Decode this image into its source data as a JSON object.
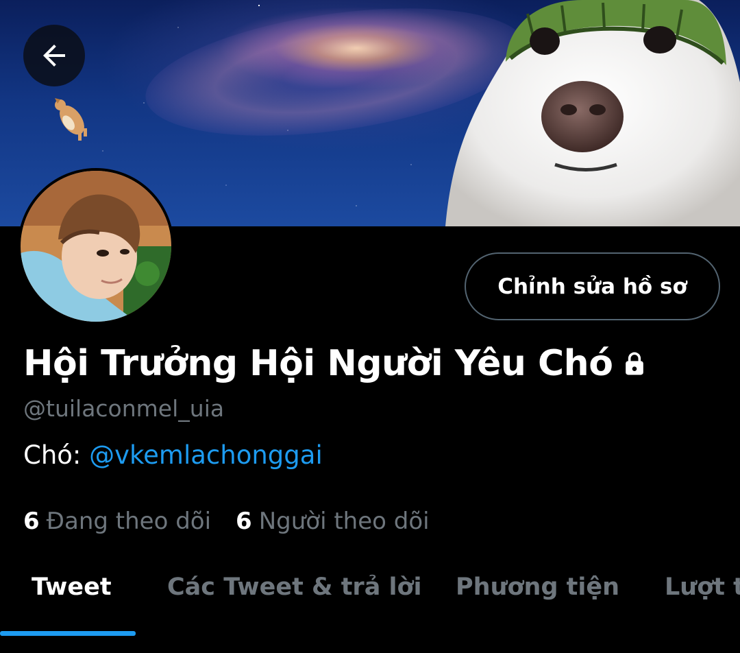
{
  "header": {
    "back_icon": "arrow-left-icon"
  },
  "profile": {
    "edit_button_label": "Chỉnh sửa hồ sơ",
    "display_name": "Hội Trưởng Hội Người Yêu Chó",
    "lock_icon": "lock-icon",
    "handle": "@tuilaconmel_uia",
    "bio_prefix": "Chó: ",
    "bio_mention": "@vkemlachonggai",
    "following_count": "6",
    "following_label": "Đang theo dõi",
    "followers_count": "6",
    "followers_label": "Người theo dõi"
  },
  "tabs": [
    {
      "label": "Tweet",
      "active": true
    },
    {
      "label": "Các Tweet & trả lời",
      "active": false
    },
    {
      "label": "Phương tiện",
      "active": false
    },
    {
      "label": "Lượt thích",
      "active": false
    }
  ],
  "colors": {
    "accent": "#1d9bf0",
    "muted": "#6e767d",
    "border": "#536471",
    "background": "#000000"
  }
}
